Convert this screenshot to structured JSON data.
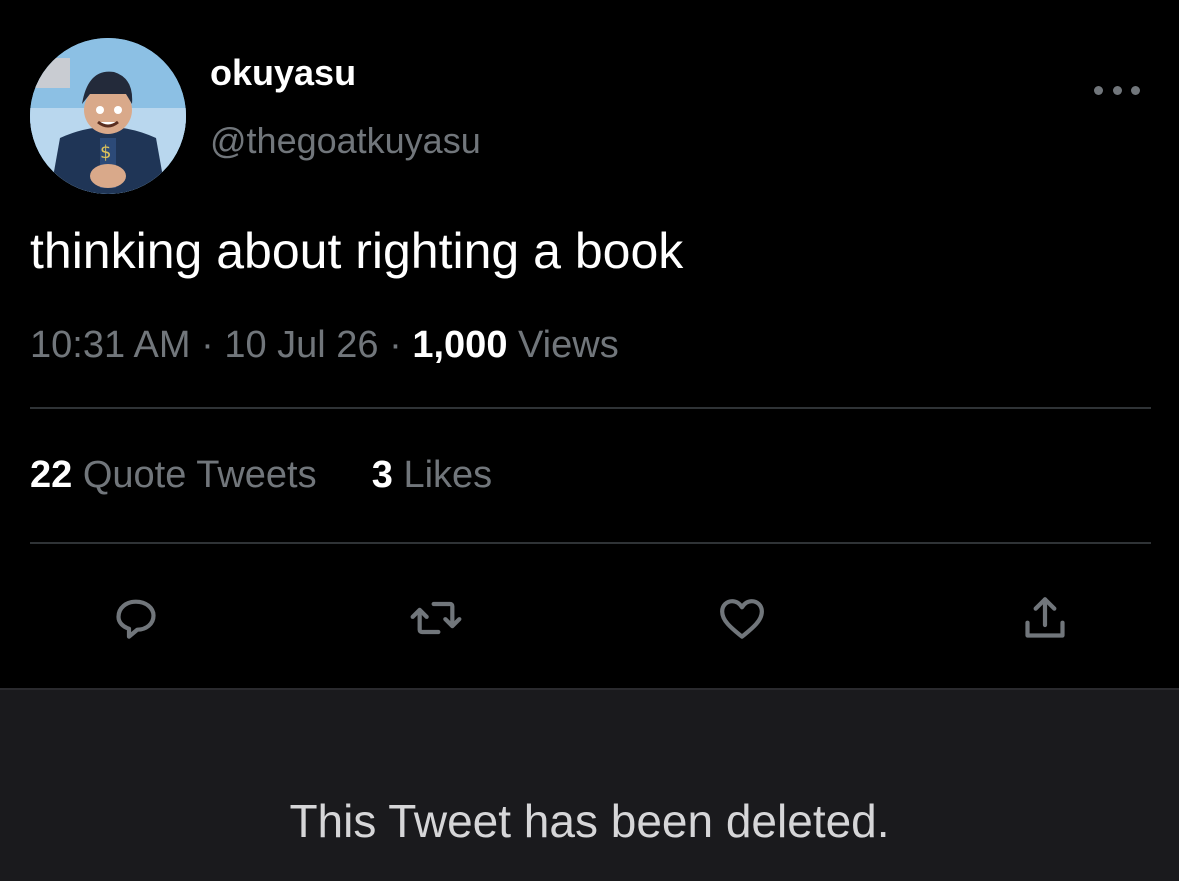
{
  "user": {
    "display_name": "okuyasu",
    "handle": "@thegoatkuyasu",
    "avatar_icon": "anime-character-avatar"
  },
  "tweet": {
    "text": "thinking about righting a book",
    "time": "10:31 AM",
    "date": "10 Jul 26",
    "separator": "·",
    "views_count": "1,000",
    "views_label": "Views"
  },
  "stats": {
    "quote_count": "22",
    "quote_label": "Quote Tweets",
    "likes_count": "3",
    "likes_label": "Likes"
  },
  "actions": {
    "icons": [
      "reply-icon",
      "retweet-icon",
      "like-icon",
      "share-icon"
    ]
  },
  "deleted_notice": {
    "text": "This Tweet has been deleted."
  },
  "colors": {
    "background": "#000000",
    "primary_text": "#ffffff",
    "secondary_text": "#71767b",
    "divider": "#2f3336",
    "deleted_panel": "#1a1a1d"
  }
}
